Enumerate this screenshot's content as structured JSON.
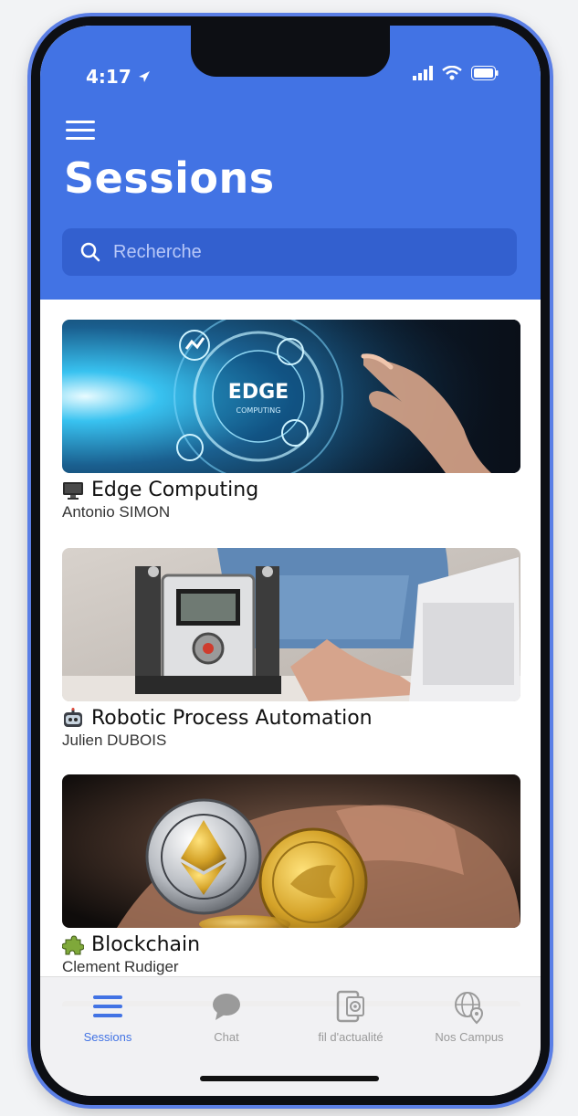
{
  "status_bar": {
    "time": "4:17"
  },
  "header": {
    "title": "Sessions",
    "search": {
      "placeholder": "Recherche"
    }
  },
  "sessions": [
    {
      "title": "Edge Computing",
      "author": "Antonio SIMON",
      "emoji": "desktop-computer-icon",
      "image_text": "EDGE",
      "image_subtext": "COMPUTING"
    },
    {
      "title": "Robotic Process Automation",
      "author": "Julien DUBOIS",
      "emoji": "robot-face-icon"
    },
    {
      "title": "Blockchain",
      "author": "Clement Rudiger",
      "emoji": "puzzle-icon"
    }
  ],
  "tabs": [
    {
      "label": "Sessions",
      "icon": "list-icon",
      "active": true
    },
    {
      "label": "Chat",
      "icon": "chat-bubble-icon",
      "active": false
    },
    {
      "label": "fil d'actualité",
      "icon": "news-feed-icon",
      "active": false
    },
    {
      "label": "Nos Campus",
      "icon": "globe-pin-icon",
      "active": false
    }
  ],
  "colors": {
    "accent": "#4273e4",
    "header_bg": "#4273e4"
  }
}
